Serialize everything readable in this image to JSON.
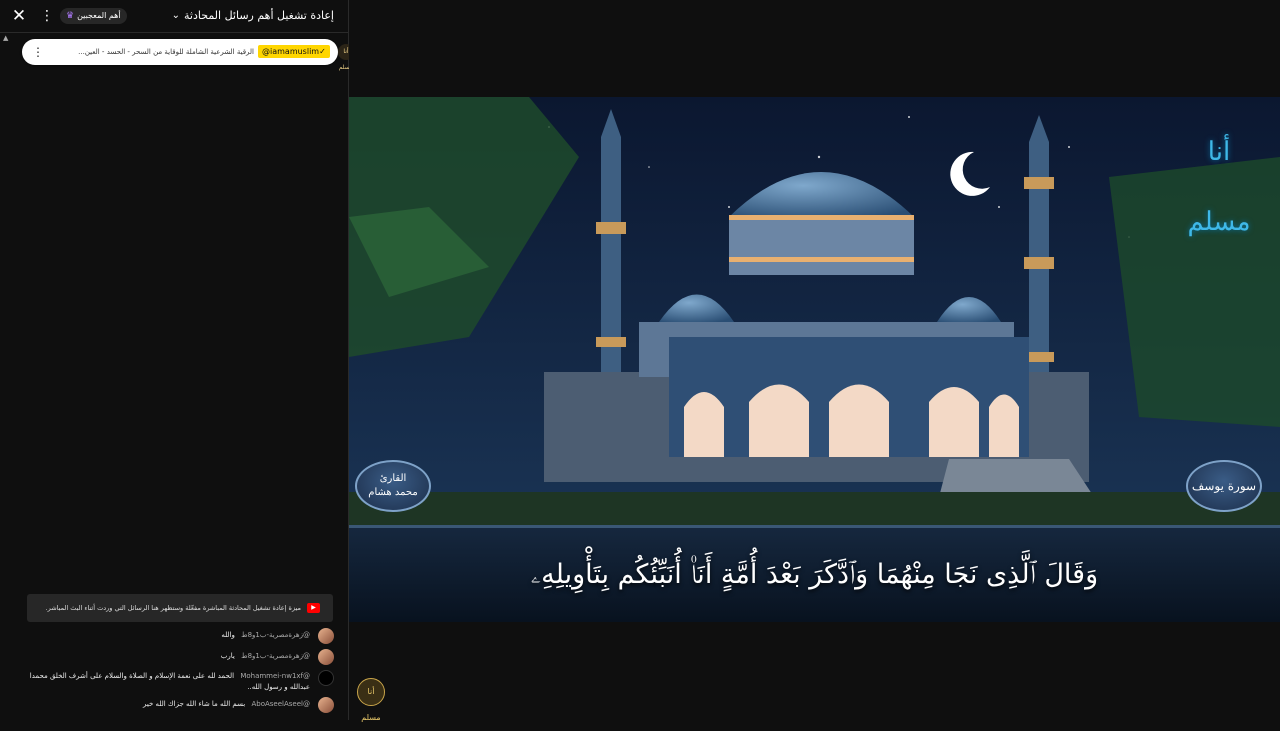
{
  "chat": {
    "header": {
      "title": "إعادة تشغيل أهم رسائل المحادثة",
      "members_label": "أهم المعجبين"
    },
    "pinned": {
      "author": "@iamamuslim✓",
      "text": "الرقية الشرعية الشاملة للوقاية من السحر - الحسد - العين...",
      "avatar_text": "أنا مسلم"
    },
    "notice": {
      "text": "ميزة إعادة تشغيل المحادثة المباشرة مفعّلة وستظهر هنا الرسائل التي وردت أثناء البث المباشر."
    },
    "messages": [
      {
        "author": "@زهرةمصرية-ب1و8ط",
        "text": "والله"
      },
      {
        "author": "@زهرةمصرية-ب1و8ط",
        "text": "يارب"
      },
      {
        "author": "@Mohammei-nw1xf",
        "text": "الحمد لله على نعمة الإسلام و الصلاة والسلام على أشرف الخلق محمدا عبدالله و رسول الله.."
      },
      {
        "author": "@AboAseelAseel",
        "text": "بسم الله ما شاء الله جزاك الله خير"
      }
    ]
  },
  "video": {
    "verse": "وَقَالَ ٱلَّذِى نَجَا مِنْهُمَا وَٱدَّكَرَ بَعْدَ أُمَّةٍ أَنَا۠ أُنَبِّئُكُم بِتَأْوِيلِهِۦ",
    "reciter_label": "القارئ",
    "reciter_name": "محمد هشام",
    "surah_name": "سورة يوسف",
    "logo_text": "أنا مسلم",
    "watermark_text": "أنا مسلم",
    "colors": {
      "sky_top": "#0b1730",
      "sky_bottom": "#1d3a5c",
      "dome": "#4a7aa6",
      "water": "#0c1a2e",
      "accent_logo": "#3fb8e8"
    }
  }
}
